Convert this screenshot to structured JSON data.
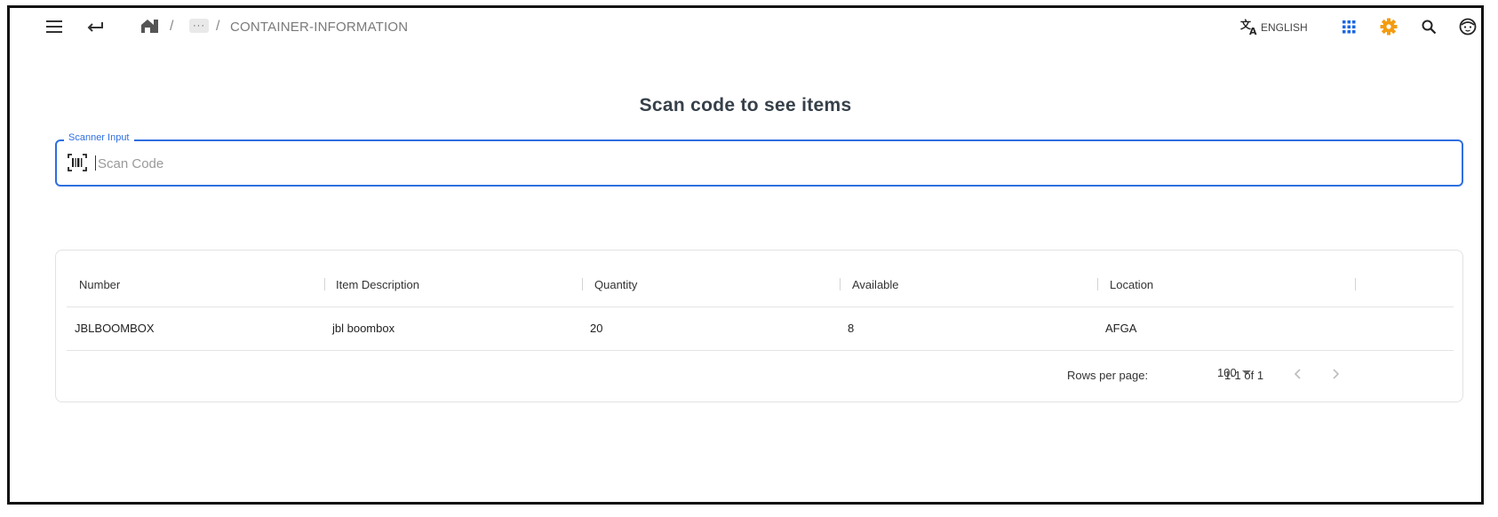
{
  "topbar": {
    "icons": [
      "menu-icon",
      "back-arrow-icon",
      "home-icon",
      "translate-icon",
      "apps-grid-icon",
      "settings-icon",
      "search-icon",
      "user-avatar-icon"
    ],
    "breadcrumb": {
      "separator": "/",
      "collapsed": "···",
      "current": "CONTAINER-INFORMATION"
    },
    "language": "ENGLISH",
    "colors": {
      "apps": "#1a66e0",
      "settings": "#f39c12"
    }
  },
  "page": {
    "title": "Scan code to see items"
  },
  "scanner": {
    "label": "Scanner Input",
    "placeholder": "Scan Code",
    "value": ""
  },
  "table": {
    "columns": [
      "Number",
      "Item Description",
      "Quantity",
      "Available",
      "Location"
    ],
    "rows": [
      [
        "JBLBOOMBOX",
        "jbl boombox",
        "20",
        "8",
        "AFGA"
      ]
    ],
    "footer": {
      "rows_per_page_label": "Rows per page:",
      "rows_per_page": "100",
      "range": "1-1 of 1"
    }
  },
  "accent_color": "#2f6fe0"
}
